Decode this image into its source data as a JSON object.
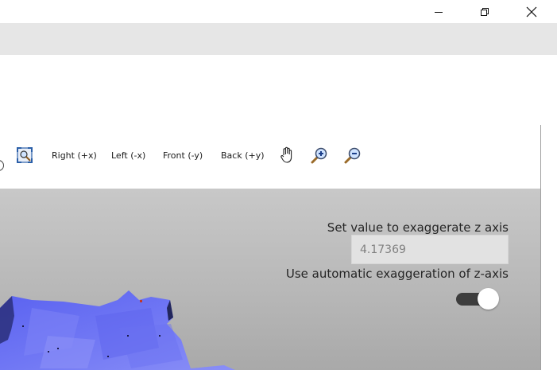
{
  "window": {
    "minimize_icon": "minimize-icon",
    "restore_icon": "restore-icon",
    "close_icon": "close-icon"
  },
  "toolbar": {
    "fit_icon": "zoom-extents-icon",
    "views": [
      {
        "label": "Right (+x)"
      },
      {
        "label": "Left (-x)"
      },
      {
        "label": "Front (-y)"
      },
      {
        "label": "Back (+y)"
      }
    ],
    "pan_icon": "hand-pan-icon",
    "zoom_in_icon": "zoom-in-icon",
    "zoom_out_icon": "zoom-out-icon"
  },
  "panel": {
    "exaggerate_label": "Set value to exaggerate z axis",
    "exaggerate_value": "4.17369",
    "auto_label": "Use automatic exaggeration of z-axis",
    "auto_enabled": true
  },
  "colors": {
    "terrain": "#6f74f2",
    "scene_bg": "#b8b8b8",
    "menubar": "#e6e6e6"
  }
}
